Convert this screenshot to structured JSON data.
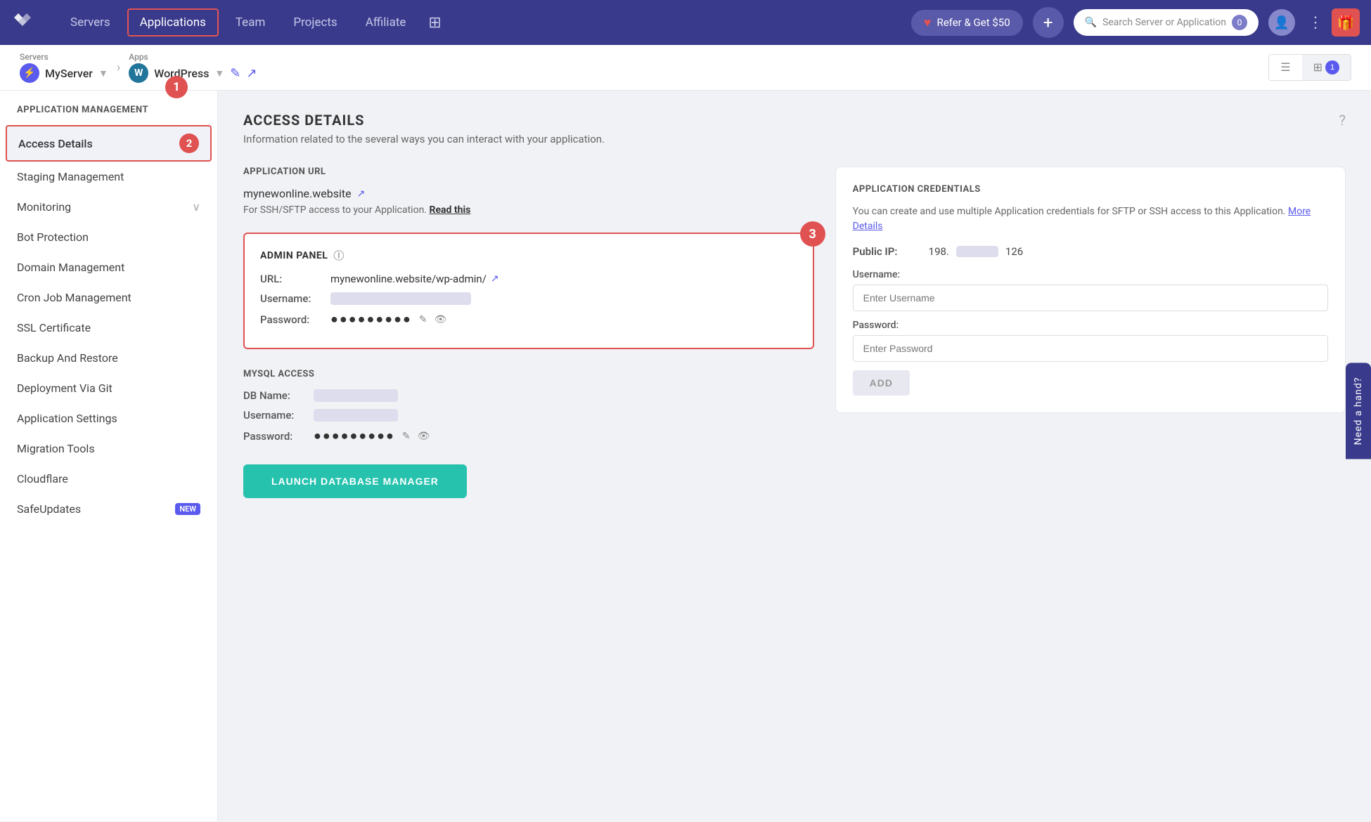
{
  "nav": {
    "logo_alt": "Cloudways",
    "items": [
      {
        "label": "Servers",
        "active": false
      },
      {
        "label": "Applications",
        "active": true
      },
      {
        "label": "Team",
        "active": false
      },
      {
        "label": "Projects",
        "active": false
      },
      {
        "label": "Affiliate",
        "active": false
      }
    ],
    "refer_label": "Refer & Get $50",
    "plus_label": "+",
    "search_placeholder": "Search Server or Application",
    "search_badge": "0",
    "dots_label": "⋮",
    "gift_label": "🎁"
  },
  "breadcrumb": {
    "servers_label": "Servers",
    "server_name": "MyServer",
    "apps_label": "Apps",
    "app_name": "WordPress",
    "step1_num": "1"
  },
  "view_toggle": {
    "list_badge": "1"
  },
  "sidebar": {
    "title": "Application Management",
    "items": [
      {
        "label": "Access Details",
        "active": true
      },
      {
        "label": "Staging Management",
        "active": false
      },
      {
        "label": "Monitoring",
        "active": false,
        "has_chevron": true
      },
      {
        "label": "Bot Protection",
        "active": false
      },
      {
        "label": "Domain Management",
        "active": false
      },
      {
        "label": "Cron Job Management",
        "active": false
      },
      {
        "label": "SSL Certificate",
        "active": false
      },
      {
        "label": "Backup And Restore",
        "active": false
      },
      {
        "label": "Deployment Via Git",
        "active": false
      },
      {
        "label": "Application Settings",
        "active": false
      },
      {
        "label": "Migration Tools",
        "active": false
      },
      {
        "label": "Cloudflare",
        "active": false
      },
      {
        "label": "SafeUpdates",
        "active": false,
        "badge": "NEW"
      }
    ]
  },
  "content": {
    "title": "ACCESS DETAILS",
    "description": "Information related to the several ways you can interact with your application.",
    "app_url_section": {
      "title": "APPLICATION URL",
      "url": "mynewonline.website",
      "ssh_note": "For SSH/SFTP access to your Application.",
      "ssh_link": "Read this"
    },
    "admin_panel": {
      "title": "ADMIN PANEL",
      "step_num": "3",
      "url_label": "URL:",
      "url_value": "mynewonline.website/wp-admin/",
      "username_label": "Username:",
      "password_label": "Password:",
      "password_dots": "●●●●●●●●●"
    },
    "mysql": {
      "title": "MYSQL ACCESS",
      "db_name_label": "DB Name:",
      "username_label": "Username:",
      "password_label": "Password:",
      "password_dots": "●●●●●●●●●",
      "launch_btn": "LAUNCH DATABASE MANAGER"
    },
    "credentials": {
      "title": "APPLICATION CREDENTIALS",
      "description": "You can create and use multiple Application credentials for SFTP or SSH access to this Application.",
      "more_link": "More Details",
      "ip_label": "Public IP:",
      "ip_start": "198.",
      "ip_end": "126",
      "username_label": "Username:",
      "username_placeholder": "Enter Username",
      "password_label": "Password:",
      "password_placeholder": "Enter Password",
      "add_btn": "ADD"
    }
  },
  "side_tab": {
    "label": "Need a hand?"
  },
  "step2_num": "2"
}
